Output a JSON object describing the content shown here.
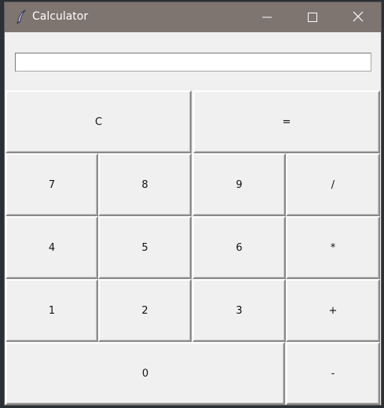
{
  "window": {
    "title": "Calculator",
    "controls": {
      "minimize_icon": "minimize-icon",
      "maximize_icon": "maximize-icon",
      "close_icon": "close-icon"
    }
  },
  "display": {
    "value": "",
    "placeholder": ""
  },
  "buttons": {
    "clear": "C",
    "equals": "=",
    "seven": "7",
    "eight": "8",
    "nine": "9",
    "divide": "/",
    "four": "4",
    "five": "5",
    "six": "6",
    "multiply": "*",
    "one": "1",
    "two": "2",
    "three": "3",
    "plus": "+",
    "zero": "0",
    "minus": "-"
  },
  "colors": {
    "titlebar": "#7e7470",
    "window_bg": "#f0f0f0",
    "display_bg": "#ffffff"
  }
}
